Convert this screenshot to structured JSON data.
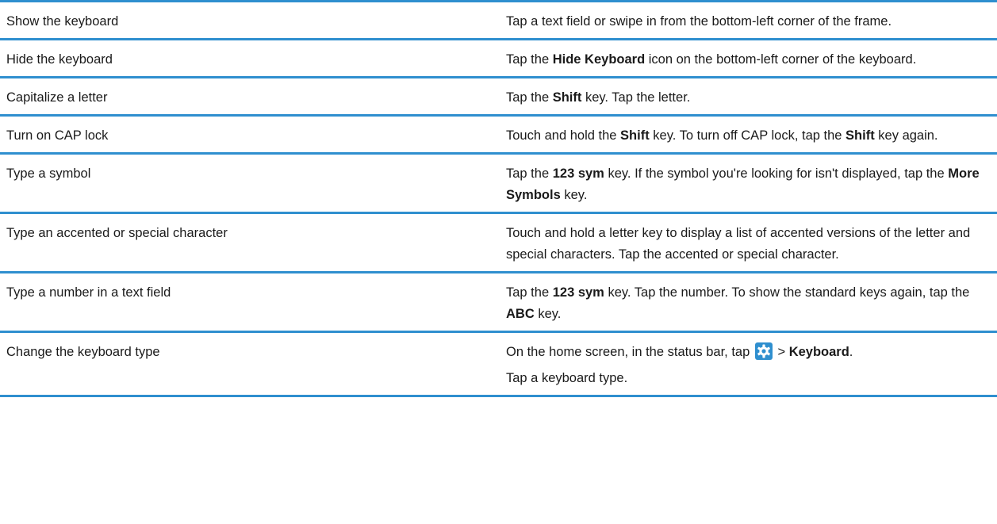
{
  "rows": [
    {
      "task": "Show the keyboard",
      "desc": [
        {
          "t": "Tap a text field or swipe in from the bottom-left corner of the frame."
        }
      ]
    },
    {
      "task": "Hide the keyboard",
      "desc": [
        {
          "t": "Tap the "
        },
        {
          "t": "Hide Keyboard",
          "b": true
        },
        {
          "t": " icon on the bottom-left corner of the keyboard."
        }
      ]
    },
    {
      "task": "Capitalize a letter",
      "desc": [
        {
          "t": "Tap the "
        },
        {
          "t": "Shift",
          "b": true
        },
        {
          "t": " key. Tap the letter."
        }
      ]
    },
    {
      "task": "Turn on CAP lock",
      "desc": [
        {
          "t": "Touch and hold the "
        },
        {
          "t": "Shift",
          "b": true
        },
        {
          "t": " key. To turn off CAP lock, tap the "
        },
        {
          "t": "Shift",
          "b": true
        },
        {
          "t": " key again."
        }
      ]
    },
    {
      "task": "Type a symbol",
      "desc": [
        {
          "t": "Tap the "
        },
        {
          "t": "123 sym",
          "b": true
        },
        {
          "t": " key. If the symbol you're looking for isn't displayed, tap the "
        },
        {
          "t": "More Symbols",
          "b": true
        },
        {
          "t": " key."
        }
      ]
    },
    {
      "task": "Type an accented or special character",
      "desc": [
        {
          "t": "Touch and hold a letter key to display a list of accented versions of the letter and special characters. Tap the accented or special character."
        }
      ]
    },
    {
      "task": "Type a number in a text field",
      "desc": [
        {
          "t": "Tap the "
        },
        {
          "t": "123 sym",
          "b": true
        },
        {
          "t": " key. Tap the number. To show the standard keys again, tap the "
        },
        {
          "t": "ABC",
          "b": true
        },
        {
          "t": " key."
        }
      ]
    }
  ],
  "last_row": {
    "task": "Change the keyboard type",
    "line1_before_icon": "On the home screen, in the status bar, tap",
    "icon": "gear-icon",
    "line1_after_icon": "> ",
    "line1_bold": "Keyboard",
    "line1_end": ".",
    "line2": "Tap a keyboard type."
  },
  "colors": {
    "rule": "#2f8fcf",
    "text": "#1a1a1a",
    "icon_bg": "#2f8fcf"
  }
}
